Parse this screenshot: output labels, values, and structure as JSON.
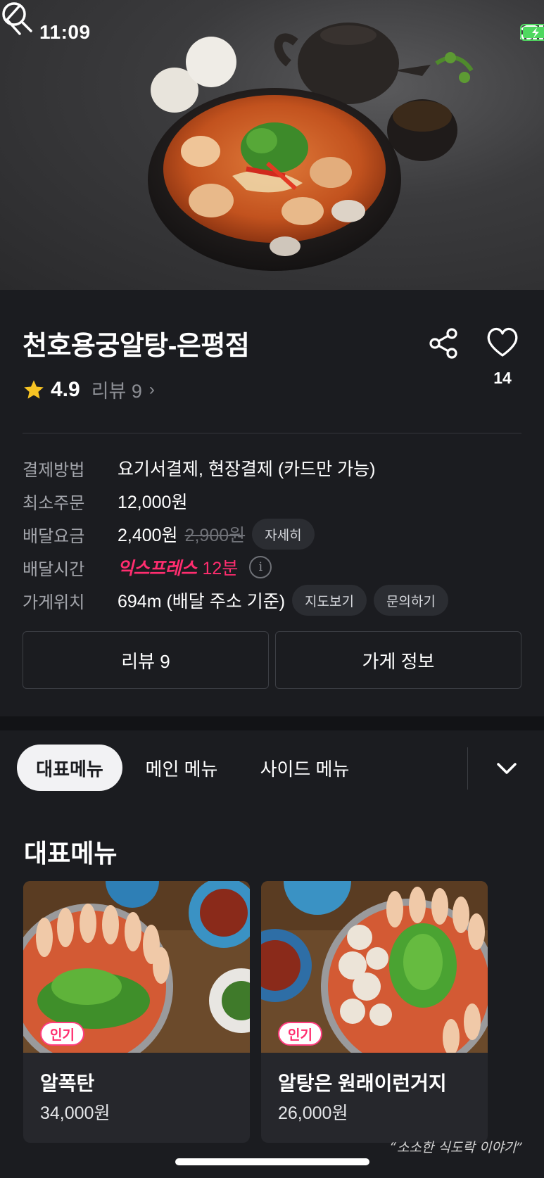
{
  "status_bar": {
    "time": "11:09"
  },
  "hero": {
    "image_description_icon": "food-photo"
  },
  "store": {
    "name": "천호용궁알탕-은평점",
    "rating": "4.9",
    "review_label": "리뷰 9",
    "review_chevron": "›",
    "like_count": "14"
  },
  "info": {
    "payment": {
      "label": "결제방법",
      "value": "요기서결제, 현장결제 (카드만 가능)"
    },
    "min_order": {
      "label": "최소주문",
      "value": "12,000원"
    },
    "delivery_fee": {
      "label": "배달요금",
      "value": "2,400원",
      "original": "2,900원",
      "detail_chip": "자세히"
    },
    "delivery_time": {
      "label": "배달시간",
      "express": "익스프레스",
      "time": "12분",
      "info_glyph": "i"
    },
    "location": {
      "label": "가게위치",
      "value": "694m (배달 주소 기준)",
      "map_chip": "지도보기",
      "inquiry_chip": "문의하기"
    }
  },
  "tabs": {
    "reviews": "리뷰 9",
    "store_info": "가게 정보"
  },
  "categories": [
    "대표메뉴",
    "메인 메뉴",
    "사이드 메뉴"
  ],
  "menu": {
    "section_title": "대표메뉴",
    "items": [
      {
        "badge": "인기",
        "name": "알폭탄",
        "price": "34,000원"
      },
      {
        "badge": "인기",
        "name": "알탕은 원래이런거지",
        "price": "26,000원"
      }
    ]
  },
  "watermark": "“소소한 식도락 이야기”",
  "colors": {
    "background": "#1b1c20",
    "accent": "#ff2d6f",
    "chip": "#2b2d32"
  }
}
